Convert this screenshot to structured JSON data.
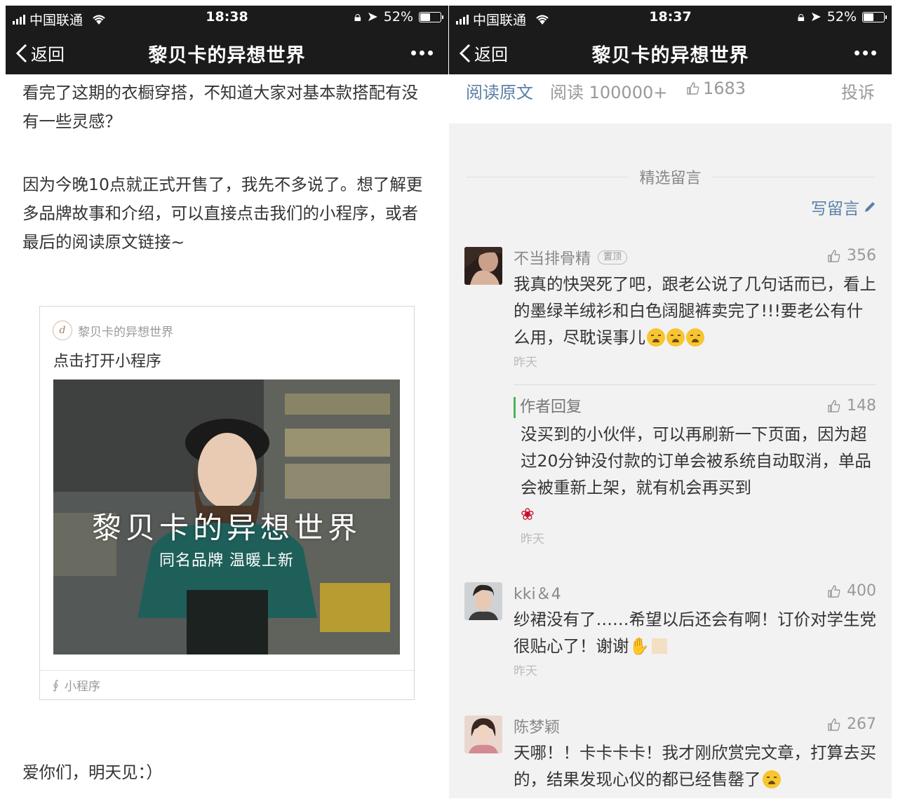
{
  "status_left": {
    "carrier": "中国联通",
    "time": "18:38",
    "battery": "52%",
    "battery_level": 0.52
  },
  "status_right": {
    "carrier": "中国联通",
    "time": "18:37",
    "battery": "52%",
    "battery_level": 0.52
  },
  "nav": {
    "back_label": "返回",
    "title": "黎贝卡的异想世界"
  },
  "article": {
    "para1": "看完了这期的衣橱穿搭，不知道大家对基本款搭配有没有一些灵感？",
    "para2": "因为今晚10点就正式开售了，我先不多说了。想了解更多品牌故事和介绍，可以直接点击我们的小程序，或者最后的阅读原文链接~",
    "para3": "爱你们，明天见：）",
    "card": {
      "account": "黎贝卡的异想世界",
      "logo_letter": "d",
      "open_label": "点击打开小程序",
      "brand_text": "黎贝卡的异想世界",
      "sub_text": "同名品牌 温暖上新",
      "footer": "小程序"
    }
  },
  "actions": {
    "read_original": "阅读原文",
    "reads": "阅读 100000+",
    "likes": "1683",
    "report": "投诉"
  },
  "comments_section": {
    "title": "精选留言",
    "write": "写留言"
  },
  "comments": [
    {
      "name": "不当排骨精",
      "pin": "置顶",
      "likes": "356",
      "text": "我真的快哭死了吧，跟老公说了几句话而已，看上的墨绿羊绒衫和白色阔腿裤卖完了!!!要老公有什么用，尽耽误事儿",
      "time": "昨天",
      "reply": {
        "label": "作者回复",
        "likes": "148",
        "text": "没买到的小伙伴，可以再刷新一下页面，因为超过20分钟没付款的订单会被系统自动取消，单品会被重新上架，就有机会再买到",
        "time": "昨天"
      }
    },
    {
      "name": "kki＆4",
      "likes": "400",
      "text": "纱裙没有了……希望以后还会有啊！订价对学生党很贴心了！谢谢",
      "time": "昨天"
    },
    {
      "name": "陈梦颖",
      "likes": "267",
      "text": "天哪！！卡卡卡卡！我才刚欣赏完文章，打算去买的，结果发现心仪的都已经售罄了",
      "time": ""
    }
  ]
}
